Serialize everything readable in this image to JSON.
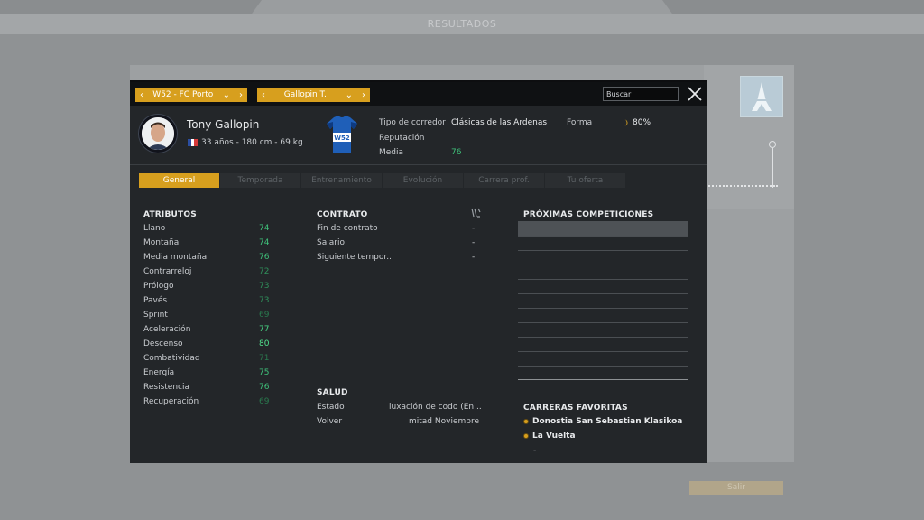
{
  "background": {
    "title": "RESULTADOS",
    "button_label": "Salir"
  },
  "header": {
    "team_selector": "W52 - FC Porto",
    "rider_selector": "Gallopin T.",
    "search_placeholder": "Buscar"
  },
  "rider": {
    "name": "Tony Gallopin",
    "info": "33 años - 180 cm - 69 kg",
    "tipo_label": "Tipo de corredor",
    "tipo_value": "Clásicas de las Ardenas",
    "reputacion_label": "Reputación",
    "media_label": "Media",
    "media_value": "76",
    "forma_label": "Forma",
    "forma_value": "80%"
  },
  "tabs": [
    "General",
    "Temporada",
    "Entrenamiento",
    "Evolución",
    "Carrera prof.",
    "Tu oferta"
  ],
  "atributos": {
    "title": "ATRIBUTOS",
    "items": [
      {
        "name": "Llano",
        "value": "74",
        "color": "#3fc27a"
      },
      {
        "name": "Montaña",
        "value": "74",
        "color": "#3fc27a"
      },
      {
        "name": "Media montaña",
        "value": "76",
        "color": "#3fc27a"
      },
      {
        "name": "Contrarreloj",
        "value": "72",
        "color": "#2f8f5a"
      },
      {
        "name": "Prólogo",
        "value": "73",
        "color": "#2f8f5a"
      },
      {
        "name": "Pavés",
        "value": "73",
        "color": "#2f8f5a"
      },
      {
        "name": "Sprint",
        "value": "69",
        "color": "#2a7a4e"
      },
      {
        "name": "Aceleración",
        "value": "77",
        "color": "#48d684"
      },
      {
        "name": "Descenso",
        "value": "80",
        "color": "#52e58f"
      },
      {
        "name": "Combatividad",
        "value": "71",
        "color": "#2a7a4e"
      },
      {
        "name": "Energía",
        "value": "75",
        "color": "#3fc27a"
      },
      {
        "name": "Resistencia",
        "value": "76",
        "color": "#3fc27a"
      },
      {
        "name": "Recuperación",
        "value": "69",
        "color": "#2a7a4e"
      }
    ]
  },
  "contrato": {
    "title": "CONTRATO",
    "rows": [
      {
        "label": "Fin de contrato",
        "value": "-"
      },
      {
        "label": "Salario",
        "value": "-"
      },
      {
        "label": "Siguiente tempor..",
        "value": "-"
      }
    ]
  },
  "salud": {
    "title": "SALUD",
    "rows": [
      {
        "label": "Estado",
        "value": "luxación de codo (En .."
      },
      {
        "label": "Volver",
        "value": "mitad Noviembre"
      }
    ]
  },
  "competiciones": {
    "title": "PRÓXIMAS COMPETICIONES"
  },
  "favoritas": {
    "title": "CARRERAS FAVORITAS",
    "items": [
      "Donostia San Sebastian Klasikoa",
      "La Vuelta"
    ],
    "extra": "-"
  },
  "colors": {
    "accent": "#d79f1e",
    "modal_bg": "#232629",
    "positive": "#3fc27a"
  }
}
